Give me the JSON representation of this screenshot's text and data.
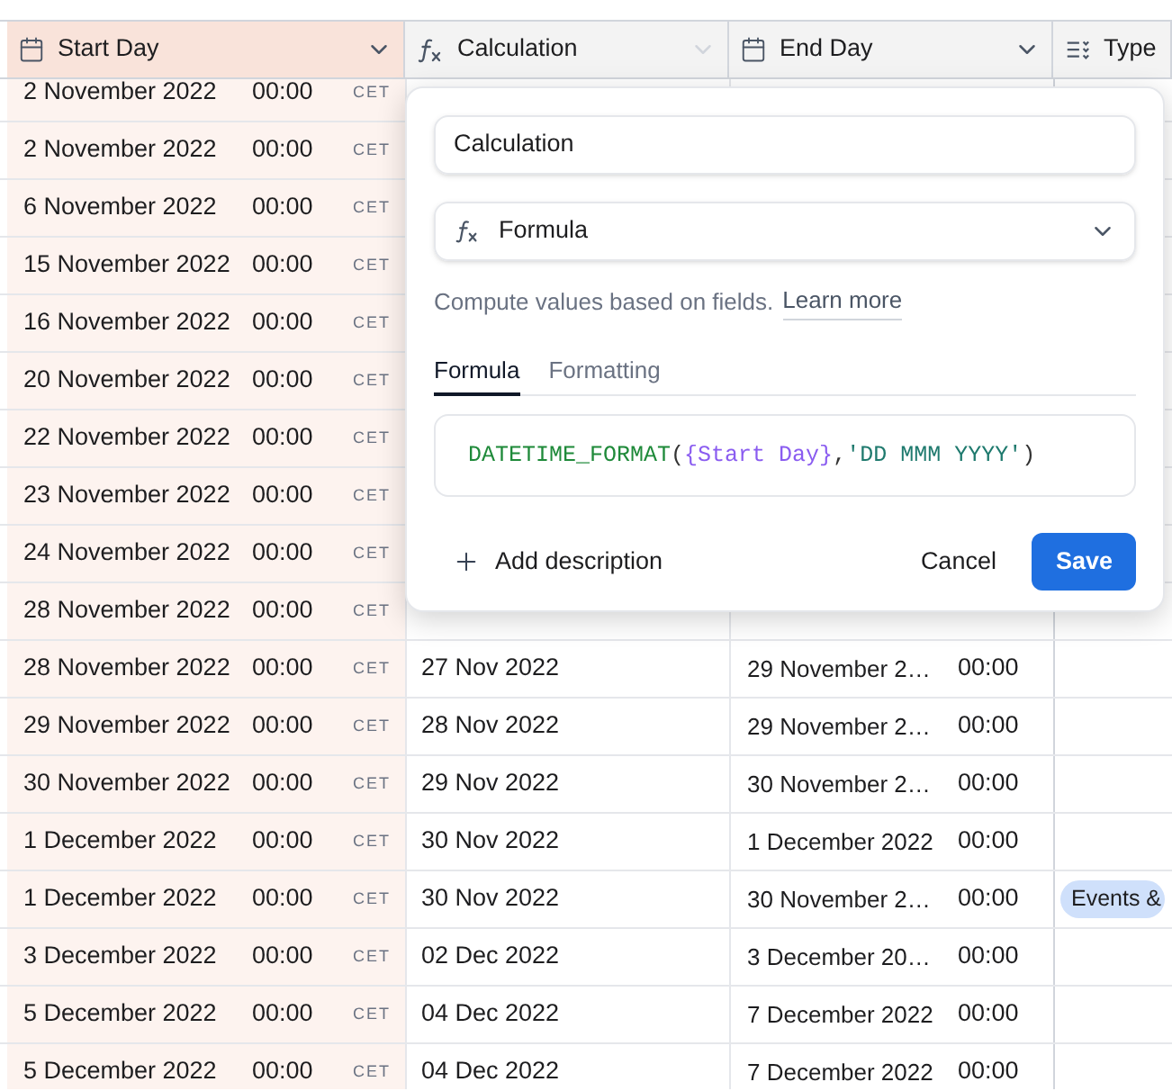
{
  "columns": [
    {
      "label": "Start Day",
      "kind": "date",
      "highlighted": true
    },
    {
      "label": "Calculation",
      "kind": "formula",
      "highlighted": false
    },
    {
      "label": "End Day",
      "kind": "date",
      "highlighted": false
    },
    {
      "label": "Type",
      "kind": "select",
      "highlighted": false
    }
  ],
  "rows": [
    {
      "start_date": "2 November 2022",
      "start_time": "00:00",
      "tz": "CET"
    },
    {
      "start_date": "2 November 2022",
      "start_time": "00:00",
      "tz": "CET"
    },
    {
      "start_date": "6 November 2022",
      "start_time": "00:00",
      "tz": "CET"
    },
    {
      "start_date": "15 November 2022",
      "start_time": "00:00",
      "tz": "CET"
    },
    {
      "start_date": "16 November 2022",
      "start_time": "00:00",
      "tz": "CET"
    },
    {
      "start_date": "20 November 2022",
      "start_time": "00:00",
      "tz": "CET"
    },
    {
      "start_date": "22 November 2022",
      "start_time": "00:00",
      "tz": "CET"
    },
    {
      "start_date": "23 November 2022",
      "start_time": "00:00",
      "tz": "CET"
    },
    {
      "start_date": "24 November 2022",
      "start_time": "00:00",
      "tz": "CET"
    },
    {
      "start_date": "28 November 2022",
      "start_time": "00:00",
      "tz": "CET"
    },
    {
      "start_date": "28 November 2022",
      "start_time": "00:00",
      "tz": "CET",
      "calc": "27 Nov 2022",
      "end_date": "29 November 2…",
      "end_time": "00:00"
    },
    {
      "start_date": "29 November 2022",
      "start_time": "00:00",
      "tz": "CET",
      "calc": "28 Nov 2022",
      "end_date": "29 November 2…",
      "end_time": "00:00"
    },
    {
      "start_date": "30 November 2022",
      "start_time": "00:00",
      "tz": "CET",
      "calc": "29 Nov 2022",
      "end_date": "30 November 2…",
      "end_time": "00:00"
    },
    {
      "start_date": "1 December 2022",
      "start_time": "00:00",
      "tz": "CET",
      "calc": "30 Nov 2022",
      "end_date": "1 December 2022",
      "end_time": "00:00"
    },
    {
      "start_date": "1 December 2022",
      "start_time": "00:00",
      "tz": "CET",
      "calc": "30 Nov 2022",
      "end_date": "30 November 2…",
      "end_time": "00:00",
      "tag": {
        "label": "Events &",
        "color": "#cfe0fb"
      }
    },
    {
      "start_date": "3 December 2022",
      "start_time": "00:00",
      "tz": "CET",
      "calc": "02 Dec 2022",
      "end_date": "3 December 20…",
      "end_time": "00:00"
    },
    {
      "start_date": "5 December 2022",
      "start_time": "00:00",
      "tz": "CET",
      "calc": "04 Dec 2022",
      "end_date": "7 December 2022",
      "end_time": "00:00"
    },
    {
      "start_date": "5 December 2022",
      "start_time": "00:00",
      "tz": "CET",
      "calc": "04 Dec 2022",
      "end_date": "7 December 2022",
      "end_time": "00:00"
    }
  ],
  "popover": {
    "name_value": "Calculation",
    "type_value": "Formula",
    "help_text": "Compute values based on fields.",
    "help_link": "Learn more",
    "tabs": [
      {
        "label": "Formula",
        "selected": true
      },
      {
        "label": "Formatting",
        "selected": false
      }
    ],
    "formula": [
      {
        "kind": "function",
        "text": "DATETIME_FORMAT"
      },
      {
        "kind": "punct",
        "text": "("
      },
      {
        "kind": "field",
        "text": "{Start Day}"
      },
      {
        "kind": "punct",
        "text": ","
      },
      {
        "kind": "string",
        "text": "'DD MMM YYYY'"
      },
      {
        "kind": "punct",
        "text": ")"
      }
    ],
    "add_description": "Add description",
    "cancel": "Cancel",
    "save": "Save"
  }
}
